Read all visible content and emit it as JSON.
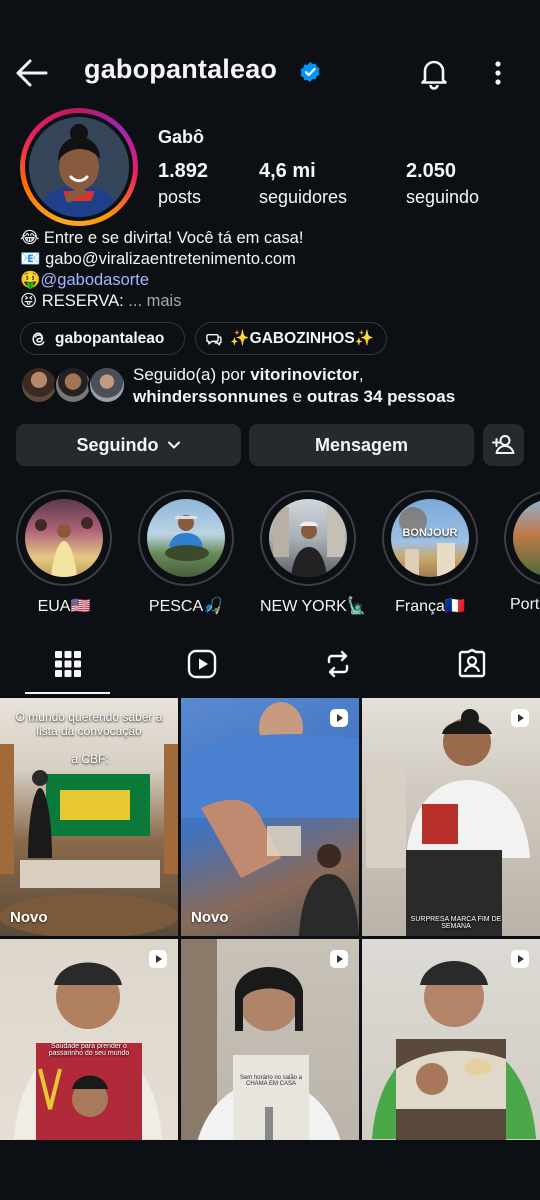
{
  "header": {
    "username": "gabopantaleao",
    "icons": {
      "back": "arrow-left-icon",
      "verified": "verified-badge-icon",
      "notifications": "bell-icon",
      "more": "more-vertical-icon"
    }
  },
  "profile": {
    "display_name": "Gabô",
    "stats": [
      {
        "value": "1.892",
        "label": "posts"
      },
      {
        "value": "4,6 mi",
        "label": "seguidores"
      },
      {
        "value": "2.050",
        "label": "seguindo"
      }
    ],
    "bio": {
      "line1": "😂 Entre e se divirta! Você tá em casa!",
      "line2": "📧 gabo@viralizaentretenimento.com",
      "line3_prefix": "🤑",
      "line3_link": "@gabodasorte",
      "line4_prefix": "😝 RESERVA: ",
      "line4_more": "... mais"
    },
    "chips": [
      {
        "label": "gabopantaleao",
        "icon": "threads-icon"
      },
      {
        "label": "✨GABOZINHOS✨",
        "icon": "broadcast-channel-icon"
      }
    ],
    "followed_by": {
      "prefix": "Seguido(a) por ",
      "user1": "vitorinovictor",
      "sep": ",",
      "user2": "whinderssonnunes",
      "mid": " e ",
      "others": "outras 34 pessoas"
    }
  },
  "actions": {
    "following_label": "Seguindo",
    "message_label": "Mensagem",
    "add_user_icon": "add-user-icon"
  },
  "highlights": [
    {
      "label": "EUA🇺🇸"
    },
    {
      "label": "PESCA🎣"
    },
    {
      "label": "NEW YORK🗽"
    },
    {
      "label": "França🇫🇷",
      "image_text": "BONJOUR"
    },
    {
      "label": "Port"
    }
  ],
  "tabs": [
    {
      "name": "grid",
      "icon": "grid-icon",
      "active": true
    },
    {
      "name": "reels",
      "icon": "reels-icon"
    },
    {
      "name": "reposts",
      "icon": "repost-icon"
    },
    {
      "name": "tagged",
      "icon": "tagged-icon"
    }
  ],
  "posts": [
    {
      "badge": "Novo",
      "overlay": "O mundo querendo saber a lista da convocação",
      "overlay2": "a CBF:"
    },
    {
      "badge": "Novo",
      "reel": true
    },
    {
      "reel": true,
      "overlay": "SURPRESA MARCA FIM DE SEMANA"
    },
    {
      "reel": true,
      "overlay": "Saudade para prender o passarinho do seu mundo"
    },
    {
      "reel": true,
      "overlay": "Sem horário no salão a CHAMA EM CASA"
    },
    {
      "reel": true
    }
  ]
}
